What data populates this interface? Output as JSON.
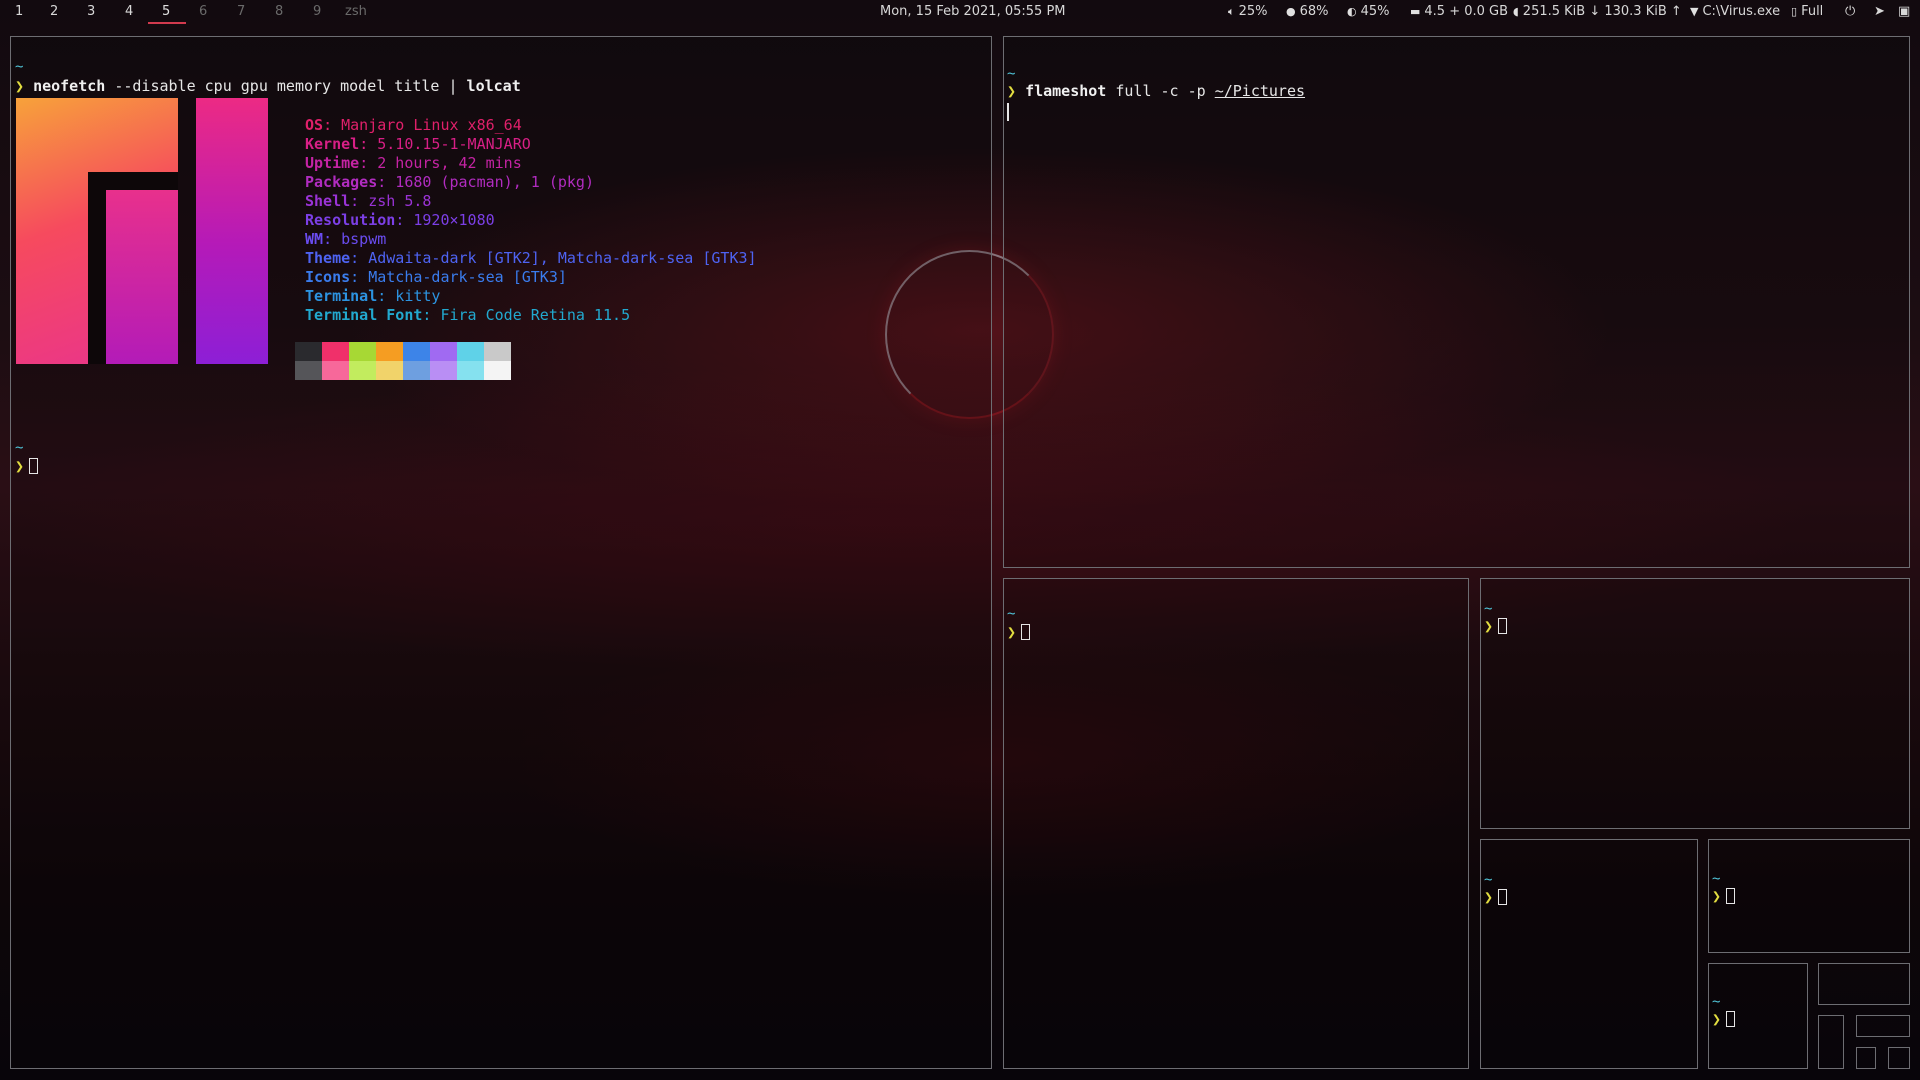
{
  "topbar": {
    "workspaces": [
      {
        "label": "1",
        "state": "normal"
      },
      {
        "label": "2",
        "state": "normal"
      },
      {
        "label": "3",
        "state": "normal"
      },
      {
        "label": "4",
        "state": "normal"
      },
      {
        "label": "5",
        "state": "active"
      },
      {
        "label": "6",
        "state": "dim"
      },
      {
        "label": "7",
        "state": "dim"
      },
      {
        "label": "8",
        "state": "dim"
      },
      {
        "label": "9",
        "state": "dim"
      },
      {
        "label": "zsh",
        "state": "dim"
      }
    ],
    "clock": "Mon, 15 Feb 2021, 05:55 PM",
    "volume": "25%",
    "mic": "68%",
    "brightness": "45%",
    "memory": "4.5 + 0.0 GB",
    "network": "251.5 KiB ↓ 130.3 KiB ↑",
    "wifi": "C:\\Virus.exe",
    "battery": "Full",
    "icons": {
      "volume": "speaker-icon",
      "mic": "microphone-icon",
      "brightness": "brightness-icon",
      "memory": "memory-icon",
      "network": "shield-icon",
      "wifi": "wifi-icon",
      "battery": "battery-icon",
      "power": "power-icon",
      "telegram": "telegram-icon",
      "lock": "lock-icon"
    }
  },
  "terminal_main": {
    "home": "~",
    "prompt_symbol": "❯",
    "cmd": "neofetch",
    "args": " --disable cpu gpu memory model title ",
    "pipe": "|",
    "pipe_target": " lolcat",
    "info": [
      {
        "key": "OS",
        "value": ": Manjaro Linux x86_64",
        "color": "#e0206a"
      },
      {
        "key": "Kernel",
        "value": ": 5.10.15-1-MANJARO",
        "color": "#d81f86"
      },
      {
        "key": "Uptime",
        "value": ": 2 hours, 42 mins",
        "color": "#c523a4"
      },
      {
        "key": "Packages",
        "value": ": 1680 (pacman), 1 (pkg)",
        "color": "#b12cc0"
      },
      {
        "key": "Shell",
        "value": ": zsh 5.8",
        "color": "#9a33d6"
      },
      {
        "key": "Resolution",
        "value": ": 1920×1080",
        "color": "#7c3fe6"
      },
      {
        "key": "WM",
        "value": ": bspwm",
        "color": "#6a4cf0"
      },
      {
        "key": "Theme",
        "value": ": Adwaita-dark [GTK2], Matcha-dark-sea [GTK3]",
        "color": "#4e63f2"
      },
      {
        "key": "Icons",
        "value": ": Matcha-dark-sea [GTK3]",
        "color": "#3a7ced"
      },
      {
        "key": "Terminal",
        "value": ": kitty",
        "color": "#2c93e0"
      },
      {
        "key": "Terminal Font",
        "value": ": Fira Code Retina 11.5",
        "color": "#22a9cf"
      }
    ],
    "palette_top": [
      "#2a2a2e",
      "#f0306a",
      "#a7d834",
      "#f59d22",
      "#3d84e8",
      "#a06af2",
      "#5fd2e8",
      "#c9c9c9"
    ],
    "palette_bottom": [
      "#555559",
      "#f7689a",
      "#c2ec5e",
      "#f1d36a",
      "#6e9fe0",
      "#b98ef4",
      "#85e1ef",
      "#f4f4f4"
    ]
  },
  "terminal_flameshot": {
    "home": "~",
    "prompt_symbol": "❯",
    "cmd": "flameshot",
    "args": " full -c -p ",
    "path": "~/Pictures"
  },
  "small_terminals": [
    {
      "home": "~",
      "prompt_symbol": "❯"
    },
    {
      "home": "~",
      "prompt_symbol": "❯"
    },
    {
      "home": "~",
      "prompt_symbol": "❯"
    },
    {
      "home": "~",
      "prompt_symbol": "❯"
    },
    {
      "home": "~",
      "prompt_symbol": "❯"
    }
  ]
}
